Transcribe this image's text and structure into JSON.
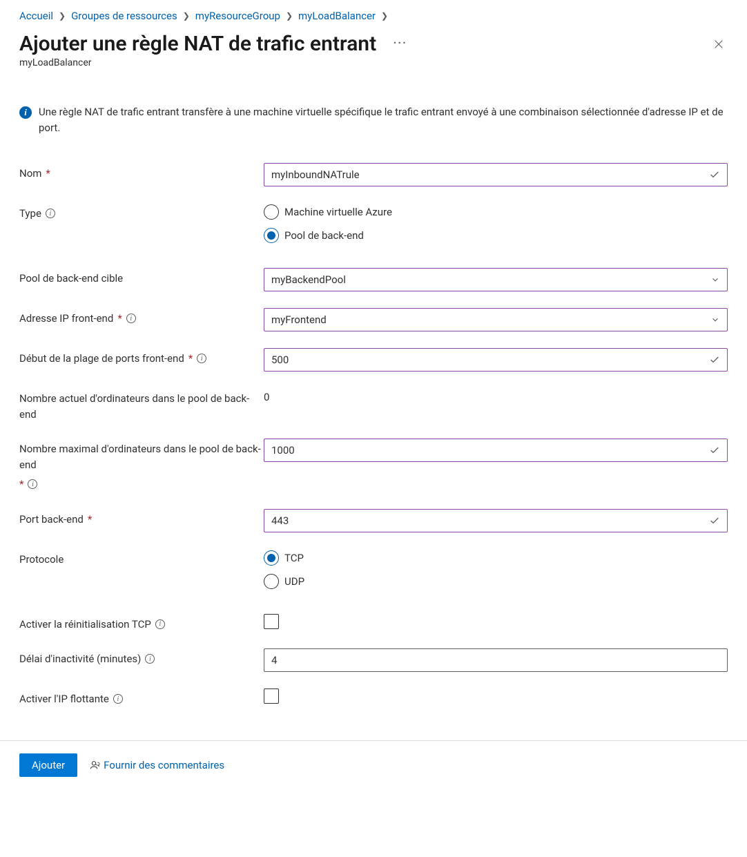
{
  "breadcrumb": [
    {
      "label": "Accueil"
    },
    {
      "label": "Groupes de ressources"
    },
    {
      "label": "myResourceGroup"
    },
    {
      "label": "myLoadBalancer"
    }
  ],
  "title": "Ajouter une règle NAT de trafic entrant",
  "subtitle": "myLoadBalancer",
  "info_text": "Une règle NAT de trafic entrant transfère à une machine virtuelle spécifique le trafic entrant envoyé à une combinaison sélectionnée d'adresse IP et de port.",
  "form": {
    "name": {
      "label": "Nom",
      "value": "myInboundNATrule"
    },
    "type": {
      "label": "Type",
      "options": [
        "Machine virtuelle Azure",
        "Pool de back-end"
      ],
      "selected": "Pool de back-end"
    },
    "backend_pool": {
      "label": "Pool de back-end cible",
      "value": "myBackendPool"
    },
    "frontend_ip": {
      "label": "Adresse IP front-end",
      "value": "myFrontend"
    },
    "frontend_port_start": {
      "label": "Début de la plage de ports front-end",
      "value": "500"
    },
    "current_machines": {
      "label": "Nombre actuel d'ordinateurs dans le pool de back-end",
      "value": "0"
    },
    "max_machines": {
      "label": "Nombre maximal d'ordinateurs dans le pool de back-end",
      "value": "1000"
    },
    "backend_port": {
      "label": "Port back-end",
      "value": "443"
    },
    "protocol": {
      "label": "Protocole",
      "options": [
        "TCP",
        "UDP"
      ],
      "selected": "TCP"
    },
    "tcp_reset": {
      "label": "Activer la réinitialisation TCP",
      "checked": false
    },
    "idle_timeout": {
      "label": "Délai d'inactivité (minutes)",
      "value": "4"
    },
    "floating_ip": {
      "label": "Activer l'IP flottante",
      "checked": false
    }
  },
  "footer": {
    "add": "Ajouter",
    "feedback": "Fournir des commentaires"
  }
}
